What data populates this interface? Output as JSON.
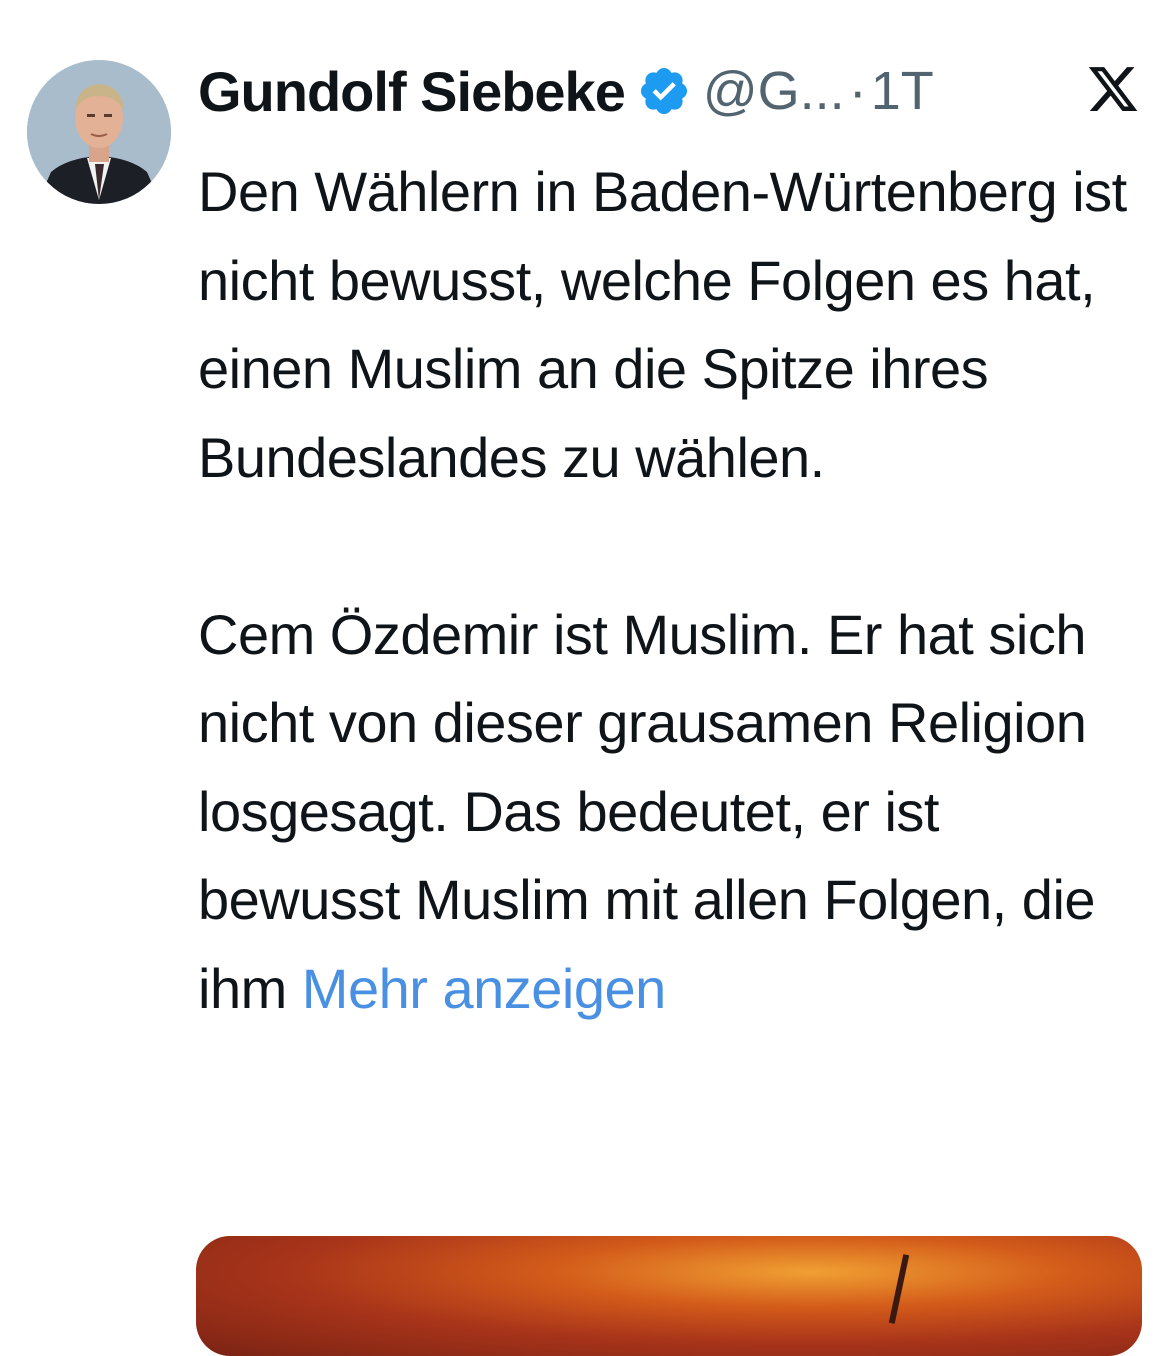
{
  "tweet": {
    "author": {
      "display_name": "Gundolf Siebeke",
      "handle": "@G...",
      "verified": true,
      "verified_icon": "verified-badge-icon"
    },
    "separator": "·",
    "time": "1T",
    "platform_icon": "x-logo-icon",
    "text": {
      "paragraph1": "Den Wählern in Baden-Würtenberg ist nicht bewusst, welche Folgen es hat, einen Muslim an die Spitze ihres Bundeslandes zu wählen.",
      "paragraph2": "Cem Özdemir ist Muslim. Er hat sich nicht von dieser grausamen Religion losgesagt. Das bedeutet, er ist bewusst Muslim mit allen Folgen, die ihm",
      "more_label": "Mehr anzeigen"
    },
    "colors": {
      "text": "#0f1419",
      "secondary": "#536471",
      "link": "#4a90e2",
      "verified": "#1d9bf0"
    }
  }
}
